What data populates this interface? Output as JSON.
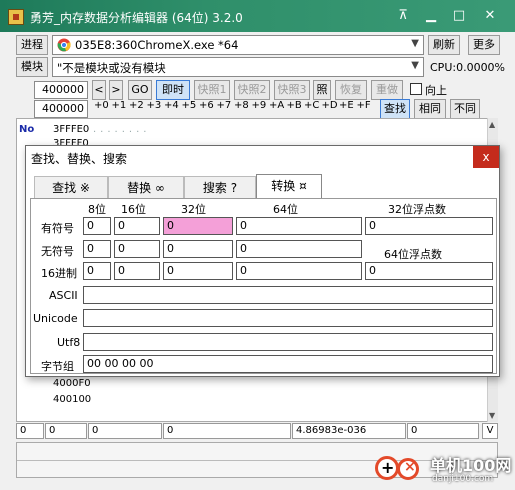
{
  "window": {
    "title": "勇芳_内存数据分析编辑器 (64位) 3.2.0"
  },
  "titlebar_icons": [
    "pin-icon",
    "minimize-icon",
    "maximize-icon",
    "close-icon"
  ],
  "toolbar1": {
    "process_label": "进程",
    "process_value": "035E8:360ChromeX.exe *64",
    "refresh_label": "刷新",
    "more_label": "更多"
  },
  "toolbar2": {
    "module_label": "模块",
    "module_value": "\"不是模块或没有模块",
    "cpu": "CPU:0.0000%"
  },
  "toolbar3": {
    "address": "400000",
    "prev": "<",
    "next": ">",
    "go": "GO",
    "realtime": "即时",
    "snap1": "快照1",
    "snap2": "快照2",
    "snap3": "快照3",
    "photo": "照",
    "restore": "恢复",
    "redo": "重做",
    "up_label": "向上"
  },
  "hexrow": {
    "address": "400000",
    "offsets": [
      "+0",
      "+1",
      "+2",
      "+3",
      "+4",
      "+5",
      "+6",
      "+7",
      "+8",
      "+9",
      "+A",
      "+B",
      "+C",
      "+D",
      "+E",
      "+F"
    ],
    "find": "查找",
    "same": "相同",
    "diff": "不同"
  },
  "hexview": {
    "no_label": "No",
    "rows_top": [
      "3FFFE0",
      "3FFFF0"
    ],
    "rows_bottom": [
      "4000F0",
      "400100"
    ],
    "dots": "........"
  },
  "dialog": {
    "title": "查找、替换、搜索",
    "close": "x",
    "tabs": [
      {
        "label": "查找 ※"
      },
      {
        "label": "替换 ∞"
      },
      {
        "label": "搜索 ?"
      },
      {
        "label": "转换 ¤"
      }
    ],
    "headers": {
      "b8": "8位",
      "b16": "16位",
      "b32": "32位",
      "b64": "64位",
      "float32": "32位浮点数",
      "float64": "64位浮点数"
    },
    "rows": {
      "signed": "有符号",
      "unsigned": "无符号",
      "hex": "16进制"
    },
    "values": {
      "v8": "0",
      "v16": "0",
      "v32": "0",
      "v64": "0",
      "f32": "0",
      "f64": "0"
    },
    "ascii_label": "ASCII",
    "unicode_label": "Unicode",
    "utf8_label": "Utf8",
    "bytes_label": "字节组",
    "bytes_value": "00 00 00 00"
  },
  "status": {
    "c1": "0",
    "c2": "0",
    "c3": "0",
    "c4": "0",
    "c5": "4.86983e-036",
    "c6": "0",
    "toggle": "V"
  },
  "watermark": {
    "site": "单机100网",
    "url": "danji100.com"
  }
}
